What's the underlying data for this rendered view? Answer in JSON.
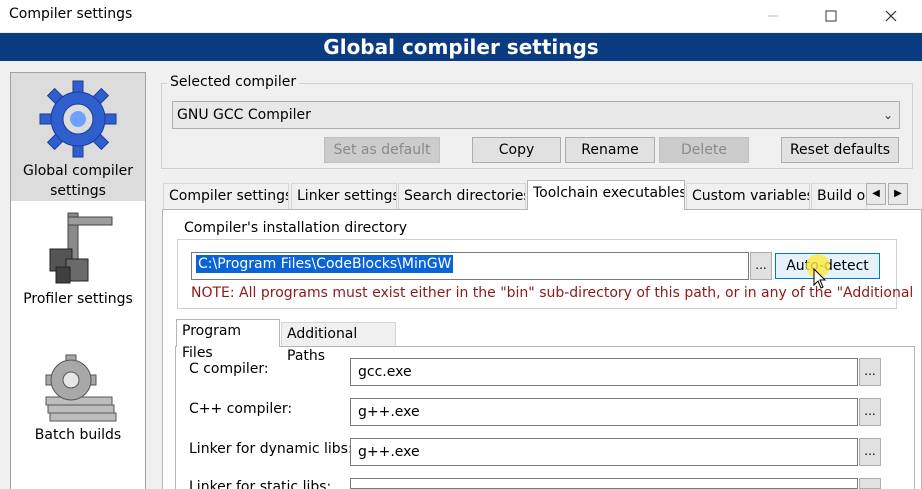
{
  "window": {
    "title": "Compiler settings",
    "controls": {
      "minimize": "—",
      "maximize": "☐",
      "close": "✕"
    }
  },
  "banner": {
    "title": "Global compiler settings"
  },
  "sidebar": {
    "items": [
      {
        "label": "Global compiler settings",
        "icon": "gear-icon",
        "selected": true
      },
      {
        "label": "Profiler settings",
        "icon": "caliper-icon",
        "selected": false
      },
      {
        "label": "Batch builds",
        "icon": "batch-gear-icon",
        "selected": false
      }
    ]
  },
  "compiler": {
    "group_label": "Selected compiler",
    "selected": "GNU GCC Compiler",
    "buttons": {
      "set_default": "Set as default",
      "copy": "Copy",
      "rename": "Rename",
      "delete": "Delete",
      "reset_defaults": "Reset defaults"
    }
  },
  "tabs": [
    {
      "label": "Compiler settings",
      "active": false
    },
    {
      "label": "Linker settings",
      "active": false
    },
    {
      "label": "Search directories",
      "active": false
    },
    {
      "label": "Toolchain executables",
      "active": true
    },
    {
      "label": "Custom variables",
      "active": false
    },
    {
      "label": "Build o",
      "active": false
    }
  ],
  "install_dir": {
    "group_label": "Compiler's installation directory",
    "value": "C:\\Program Files\\CodeBlocks\\MinGW",
    "browse": "...",
    "auto_detect": "Auto-detect",
    "note": "NOTE: All programs must exist either in the \"bin\" sub-directory of this path, or in any of the \"Additional"
  },
  "subtabs": [
    {
      "label": "Program Files",
      "active": true
    },
    {
      "label": "Additional Paths",
      "active": false
    }
  ],
  "programs": [
    {
      "label": "C compiler:",
      "value": "gcc.exe"
    },
    {
      "label": "C++ compiler:",
      "value": "g++.exe"
    },
    {
      "label": "Linker for dynamic libs:",
      "value": "g++.exe"
    },
    {
      "label": "Linker for static libs:",
      "value": ""
    }
  ],
  "colors": {
    "banner": "#0b3b80",
    "selection": "#0a64d6",
    "note": "#8b1a1a"
  }
}
